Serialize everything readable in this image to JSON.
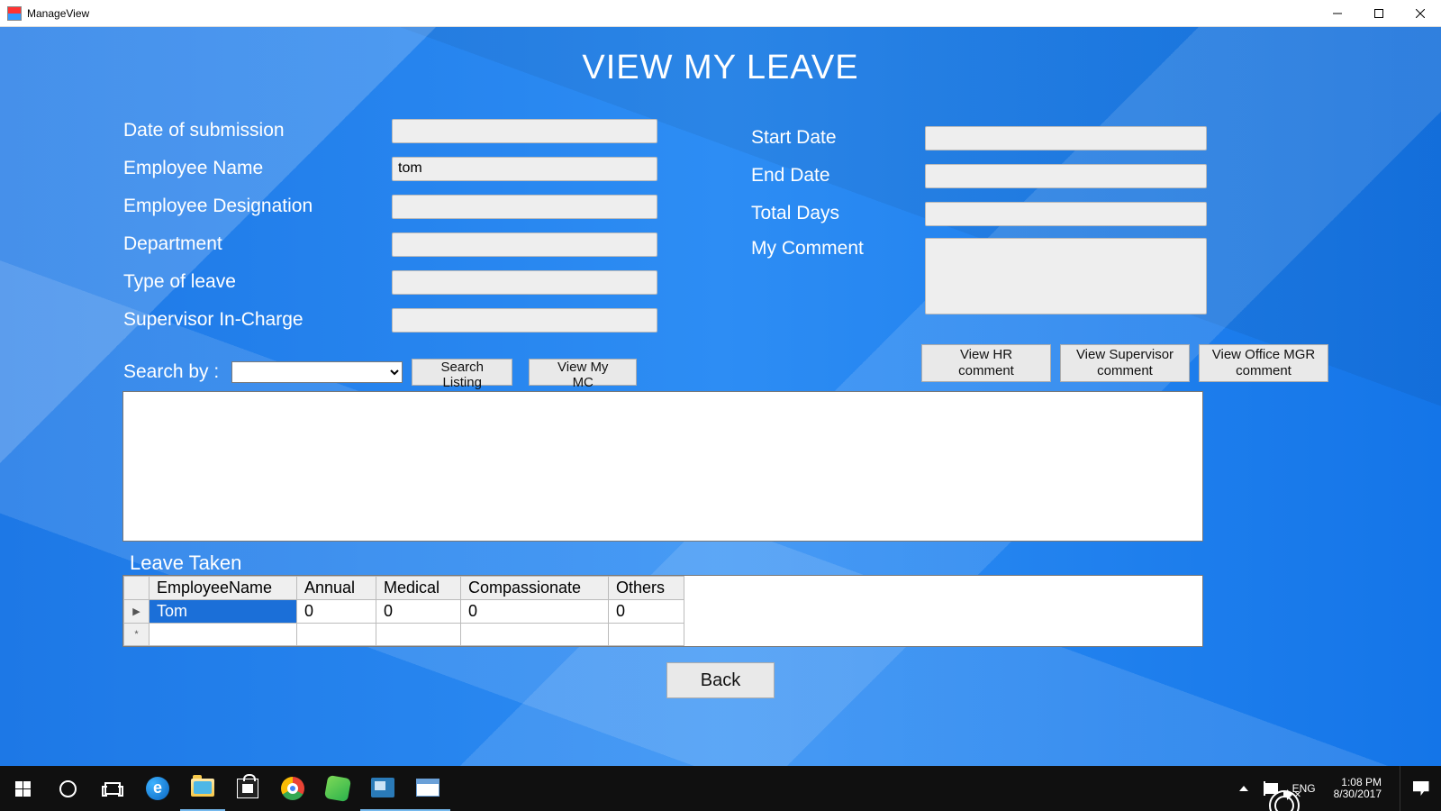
{
  "window": {
    "title": "ManageView"
  },
  "page": {
    "heading": "VIEW MY LEAVE"
  },
  "form_left": {
    "date_of_submission": {
      "label": "Date of submission",
      "value": ""
    },
    "employee_name": {
      "label": "Employee Name",
      "value": "tom"
    },
    "employee_designation": {
      "label": "Employee Designation",
      "value": ""
    },
    "department": {
      "label": "Department",
      "value": ""
    },
    "type_of_leave": {
      "label": "Type of leave",
      "value": ""
    },
    "supervisor": {
      "label": "Supervisor In-Charge",
      "value": ""
    }
  },
  "form_right": {
    "start_date": {
      "label": "Start Date",
      "value": ""
    },
    "end_date": {
      "label": "End Date",
      "value": ""
    },
    "total_days": {
      "label": "Total Days",
      "value": ""
    },
    "my_comment": {
      "label": "My Comment",
      "value": ""
    }
  },
  "search": {
    "label": "Search by :",
    "combo_value": "",
    "btn_search_listing": "Search Listing",
    "btn_view_my_mc": "View My MC"
  },
  "comment_buttons": {
    "hr": "View HR comment",
    "supervisor": "View Supervisor comment",
    "office_mgr": "View Office MGR comment"
  },
  "leave_taken": {
    "label": "Leave Taken",
    "columns": [
      "EmployeeName",
      "Annual",
      "Medical",
      "Compassionate",
      "Others"
    ],
    "rows": [
      {
        "EmployeeName": "Tom",
        "Annual": "0",
        "Medical": "0",
        "Compassionate": "0",
        "Others": "0"
      }
    ]
  },
  "back_button": "Back",
  "taskbar": {
    "lang": "ENG",
    "time": "1:08 PM",
    "date": "8/30/2017"
  }
}
